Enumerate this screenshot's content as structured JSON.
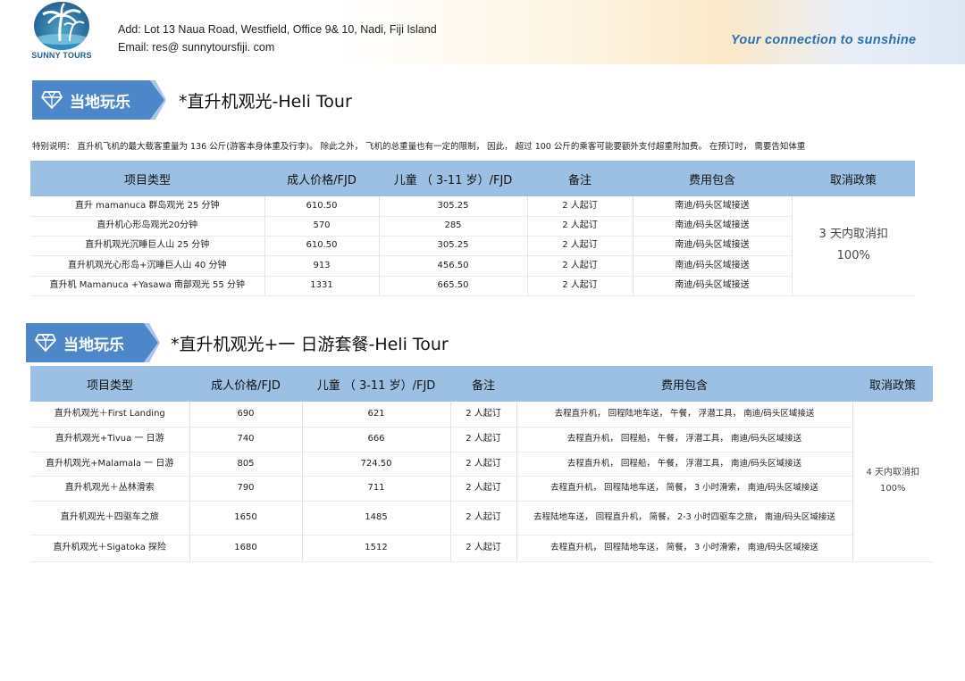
{
  "header": {
    "logo_text": "SUNNY TOURS",
    "address": "Add:  Lot 13  Naua Road,  Westfield,  Office 9& 10,  Nadi, Fiji Island",
    "email": "Email:   res@ sunnytoursfiji. com",
    "slogan": "Your  connection  to  sunshine"
  },
  "section1": {
    "badge": "当地玩乐",
    "title": "*直升机观光-Heli  Tour",
    "note": "特别说明：   直升机飞机的最大载客重量为 136 公斤(游客本身体重及行李)。   除此之外，   飞机的总重量也有一定的限制，   因此，   超过 100 公斤的乘客可能要额外支付超重附加费。   在预订时，   需要告知体重",
    "headers": [
      "项目类型",
      "成人价格/FJD",
      "儿童 （ 3-11 岁）/FJD",
      "备注",
      "费用包含",
      "取消政策"
    ],
    "rows": [
      {
        "name": "直升  mamanuca  群岛观光  25  分钟",
        "adult": "610.50",
        "child": "305.25",
        "note": "2  人起订",
        "incl": "南迪/码头区域接送"
      },
      {
        "name": "直升机心形岛观光20分钟",
        "adult": "570",
        "child": "285",
        "note": "2  人起订",
        "incl": "南迪/码头区域接送"
      },
      {
        "name": "直升机观光沉睡巨人山  25  分钟",
        "adult": "610.50",
        "child": "305.25",
        "note": "2  人起订",
        "incl": "南迪/码头区域接送"
      },
      {
        "name": "直升机观光心形岛+沉睡巨人山   40  分钟",
        "adult": "913",
        "child": "456.50",
        "note": "2  人起订",
        "incl": "南迪/码头区域接送"
      },
      {
        "name": "直升机  Mamanuca  +Yasawa  南部观光  55  分钟",
        "adult": "1331",
        "child": "665.50",
        "note": "2  人起订",
        "incl": "南迪/码头区域接送"
      }
    ],
    "policy_line1": "3 天内取消扣",
    "policy_line2": "100%"
  },
  "section2": {
    "badge": "当地玩乐",
    "title": "*直升机观光+一  日游套餐-Heli  Tour",
    "headers": [
      "项目类型",
      "成人价格/FJD",
      "儿童 （ 3-11 岁）/FJD",
      "备注",
      "费用包含",
      "取消政策"
    ],
    "rows": [
      {
        "name": "直升机观光＋First  Landing",
        "adult": "690",
        "child": "621",
        "note": "2  人起订",
        "incl": "去程直升机，    回程陆地车送，     午餐，     浮潜工具，     南迪/码头区域接送"
      },
      {
        "name": "直升机观光+Tivua  一  日游",
        "adult": "740",
        "child": "666",
        "note": "2  人起订",
        "incl": "去程直升机，     回程船，     午餐，     浮潜工具，     南迪/码头区域接送"
      },
      {
        "name": "直升机观光+Malamala  一  日游",
        "adult": "805",
        "child": "724.50",
        "note": "2  人起订",
        "incl": "去程直升机，     回程船，     午餐，     浮潜工具，     南迪/码头区域接送"
      },
      {
        "name": "直升机观光＋丛林滑索",
        "adult": "790",
        "child": "711",
        "note": "2  人起订",
        "incl": "去程直升机，    回程陆地车送，     简餐，     3  小时滑索，     南迪/码头区域接送"
      },
      {
        "name": "直升机观光＋四驱车之旅",
        "adult": "1650",
        "child": "1485",
        "note": "2  人起订",
        "incl": "去程陆地车送，     回程直升机，     简餐，     2-3  小时四驱车之旅，     南迪/码头区域接送"
      },
      {
        "name": "直升机观光＋Sigatoka  探险",
        "adult": "1680",
        "child": "1512",
        "note": "2  人起订",
        "incl": "去程直升机，    回程陆地车送，     简餐，     3  小时滑索，     南迪/码头区域接送"
      }
    ],
    "policy_line1": "4  天内取消扣",
    "policy_line2": "100%"
  },
  "colors": {
    "header_row": "#9cc0e3",
    "banner": "#4d86c9",
    "slogan": "#2d6fb3"
  }
}
